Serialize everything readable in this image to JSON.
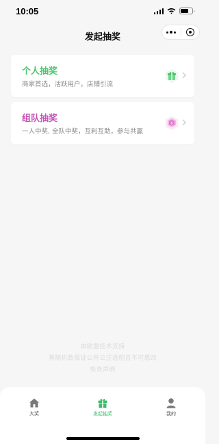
{
  "status_bar": {
    "time": "10:05"
  },
  "nav": {
    "title": "发起抽奖"
  },
  "cards": [
    {
      "title": "个人抽奖",
      "subtitle": "商家首选，活跃用户，店铺引流",
      "title_color": "#4cc66e",
      "icon": "gift-icon"
    },
    {
      "title": "组队抽奖",
      "subtitle": "一人中奖, 全队中奖，互利互助，参与共赢",
      "title_color": "#c655b8",
      "icon": "team-gift-icon"
    }
  ],
  "footer": {
    "line1": "由欧盟技术支持",
    "line2": "真随机数保证公开公正透明且不可篡改",
    "line3": "免责声明"
  },
  "tabs": [
    {
      "label": "大奖",
      "icon": "house-icon",
      "active": false
    },
    {
      "label": "发起抽奖",
      "icon": "gift-icon",
      "active": true
    },
    {
      "label": "我的",
      "icon": "user-icon",
      "active": false
    }
  ],
  "colors": {
    "accent_green": "#3dbd6b",
    "accent_pink": "#c655b8",
    "background": "#f6f6f6"
  }
}
